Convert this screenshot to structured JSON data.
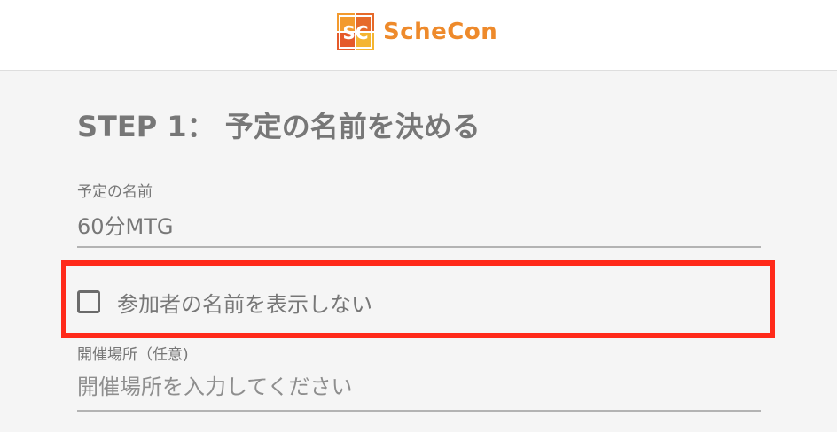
{
  "header": {
    "logo_text": "ScheCon",
    "logo_mark": "SC"
  },
  "step": {
    "title": "STEP 1： 予定の名前を決める"
  },
  "schedule_name": {
    "label": "予定の名前",
    "value": "60分MTG"
  },
  "hide_participants": {
    "label": "参加者の名前を表示しない",
    "checked": false
  },
  "location": {
    "label": "開催場所（任意)",
    "placeholder": "開催場所を入力してください",
    "value": ""
  },
  "colors": {
    "brand": "#ee8a2b",
    "highlight": "#ff2a1a"
  }
}
